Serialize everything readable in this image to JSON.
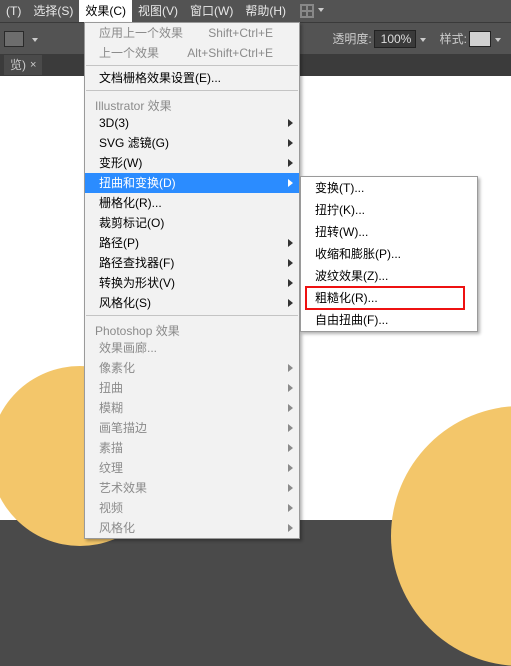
{
  "menubar": {
    "items": [
      {
        "label": "(T)"
      },
      {
        "label": "选择(S)"
      },
      {
        "label": "效果(C)",
        "active": true
      },
      {
        "label": "视图(V)"
      },
      {
        "label": "窗口(W)"
      },
      {
        "label": "帮助(H)"
      }
    ]
  },
  "optbar": {
    "opacity_label": "透明度:",
    "opacity_value": "100%",
    "style_label": "样式:"
  },
  "tab": {
    "title": "览)",
    "close": "×"
  },
  "menu_effects": {
    "apply_last": "应用上一个效果",
    "apply_last_sc": "Shift+Ctrl+E",
    "last": "上一个效果",
    "last_sc": "Alt+Shift+Ctrl+E",
    "doc_raster": "文档栅格效果设置(E)...",
    "sect_ai": "Illustrator 效果",
    "ai_items": [
      {
        "l": "3D(3)",
        "sub": true
      },
      {
        "l": "SVG 滤镜(G)",
        "sub": true
      },
      {
        "l": "变形(W)",
        "sub": true
      },
      {
        "l": "扭曲和变换(D)",
        "sub": true,
        "hi": true
      },
      {
        "l": "栅格化(R)..."
      },
      {
        "l": "裁剪标记(O)"
      },
      {
        "l": "路径(P)",
        "sub": true
      },
      {
        "l": "路径查找器(F)",
        "sub": true
      },
      {
        "l": "转换为形状(V)",
        "sub": true
      },
      {
        "l": "风格化(S)",
        "sub": true
      }
    ],
    "sect_ps": "Photoshop 效果",
    "ps_items": [
      {
        "l": "效果画廊..."
      },
      {
        "l": "像素化",
        "sub": true
      },
      {
        "l": "扭曲",
        "sub": true
      },
      {
        "l": "模糊",
        "sub": true
      },
      {
        "l": "画笔描边",
        "sub": true
      },
      {
        "l": "素描",
        "sub": true
      },
      {
        "l": "纹理",
        "sub": true
      },
      {
        "l": "艺术效果",
        "sub": true
      },
      {
        "l": "视频",
        "sub": true
      },
      {
        "l": "风格化",
        "sub": true
      }
    ]
  },
  "submenu_distort": {
    "items": [
      {
        "l": "变换(T)..."
      },
      {
        "l": "扭拧(K)..."
      },
      {
        "l": "扭转(W)..."
      },
      {
        "l": "收缩和膨胀(P)..."
      },
      {
        "l": "波纹效果(Z)..."
      },
      {
        "l": "粗糙化(R)...",
        "boxed": true
      },
      {
        "l": "自由扭曲(F)..."
      }
    ]
  }
}
